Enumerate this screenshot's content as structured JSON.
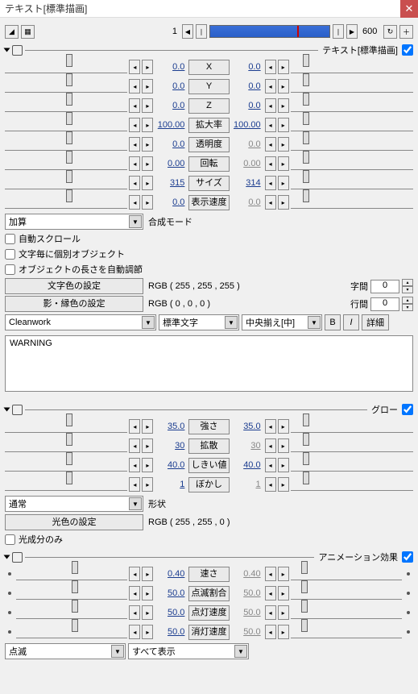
{
  "window": {
    "title": "テキスト[標準描画]"
  },
  "timeline": {
    "start": "1",
    "end": "600"
  },
  "sections": {
    "text": {
      "header_label": "テキスト[標準描画]",
      "params": [
        {
          "label": "X",
          "lval": "0.0",
          "rval": "0.0"
        },
        {
          "label": "Y",
          "lval": "0.0",
          "rval": "0.0"
        },
        {
          "label": "Z",
          "lval": "0.0",
          "rval": "0.0"
        },
        {
          "label": "拡大率",
          "lval": "100.00",
          "rval": "100.00"
        },
        {
          "label": "透明度",
          "lval": "0.0",
          "rval": "0.0",
          "rdim": true
        },
        {
          "label": "回転",
          "lval": "0.00",
          "rval": "0.00",
          "rdim": true
        },
        {
          "label": "サイズ",
          "lval": "315",
          "rval": "314"
        },
        {
          "label": "表示速度",
          "lval": "0.0",
          "rval": "0.0",
          "rdim": true
        }
      ],
      "blend": {
        "value": "加算",
        "label": "合成モード"
      },
      "checks": {
        "autoscroll": "自動スクロール",
        "per_char": "文字毎に個別オブジェクト",
        "auto_len": "オブジェクトの長さを自動調節"
      },
      "text_color_btn": "文字色の設定",
      "text_color_rgb": "RGB ( 255 , 255 , 255 )",
      "shadow_color_btn": "影・縁色の設定",
      "shadow_color_rgb": "RGB ( 0 , 0 , 0 )",
      "char_spacing_label": "字間",
      "char_spacing": "0",
      "line_spacing_label": "行間",
      "line_spacing": "0",
      "font": "Cleanwork",
      "rendering": "標準文字",
      "align": "中央揃え[中]",
      "b_label": "B",
      "i_label": "I",
      "detail_label": "詳細",
      "text_content": "WARNING"
    },
    "glow": {
      "header_label": "グロー",
      "params": [
        {
          "label": "強さ",
          "lval": "35.0",
          "rval": "35.0"
        },
        {
          "label": "拡散",
          "lval": "30",
          "rval": "30",
          "rdim": true
        },
        {
          "label": "しきい値",
          "lval": "40.0",
          "rval": "40.0"
        },
        {
          "label": "ぼかし",
          "lval": "1",
          "rval": "1",
          "rdim": true
        }
      ],
      "shape": {
        "value": "通常",
        "label": "形状"
      },
      "light_color_btn": "光色の設定",
      "light_color_rgb": "RGB ( 255 , 255 , 0 )",
      "light_only": "光成分のみ"
    },
    "anim": {
      "header_label": "アニメーション効果",
      "params": [
        {
          "label": "速さ",
          "lval": "0.40",
          "rval": "0.40",
          "rdim": true
        },
        {
          "label": "点滅割合",
          "lval": "50.0",
          "rval": "50.0",
          "rdim": true
        },
        {
          "label": "点灯速度",
          "lval": "50.0",
          "rval": "50.0",
          "rdim": true
        },
        {
          "label": "消灯速度",
          "lval": "50.0",
          "rval": "50.0",
          "rdim": true
        }
      ],
      "type": "点滅",
      "display": "すべて表示"
    }
  }
}
